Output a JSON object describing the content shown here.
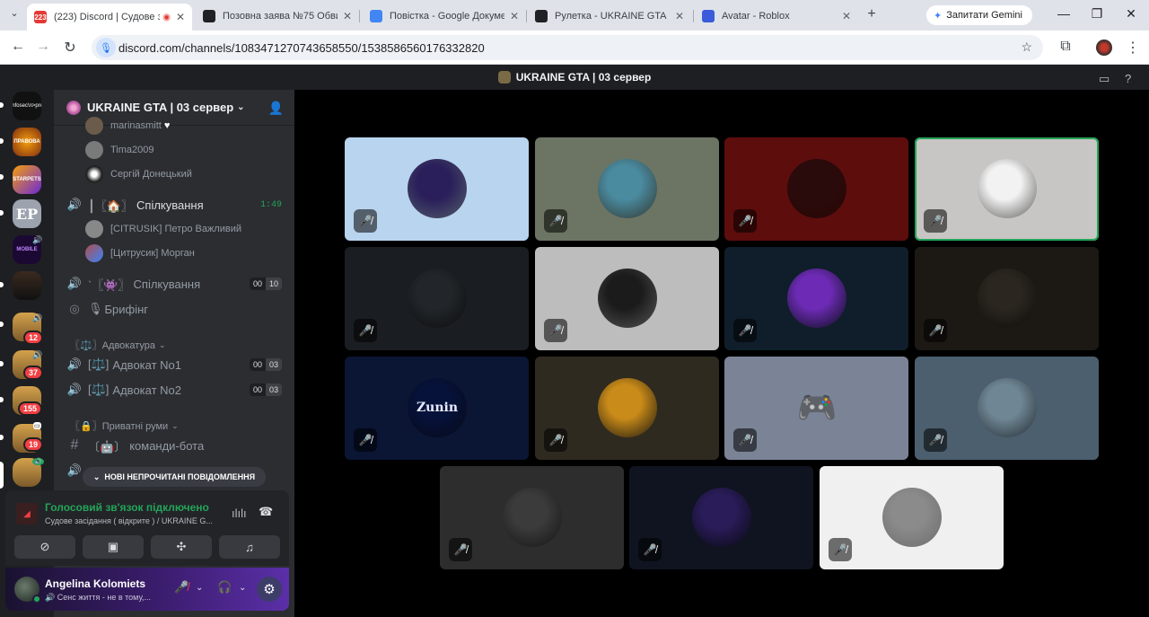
{
  "browser": {
    "tabs": [
      {
        "label": "(223) Discord | Судове за",
        "favicon_color": "#e53935",
        "favicon_text": "223"
      },
      {
        "label": "Позовна заява №75 Обвин",
        "favicon_color": "#202124",
        "favicon_text": ""
      },
      {
        "label": "Повістка - Google Докумен",
        "favicon_color": "#4285f4",
        "favicon_text": ""
      },
      {
        "label": "Рулетка - UKRAINE GTA",
        "favicon_color": "#202124",
        "favicon_text": ""
      },
      {
        "label": "Avatar - Roblox",
        "favicon_color": "#3b5bdb",
        "favicon_text": ""
      }
    ],
    "new_tab": "+",
    "gemini_label": "Запитати Gemini",
    "url": "discord.com/channels/1083471270743658550/1538586560176332820"
  },
  "discord": {
    "title": "UKRAINE GTA | 03 сервер",
    "server_name": "UKRAINE GTA | 03 сервер",
    "rail": [
      {
        "text": "#infosec\\n>prep",
        "color": "#111"
      },
      {
        "text": "ПРАВОВА",
        "color": "#c0392b"
      },
      {
        "text": "STARPETS",
        "color": "#6d28d9"
      },
      {
        "text": "EP",
        "color": "#9ca3af"
      },
      {
        "text": "MOBILE",
        "color": "#3b0764"
      },
      {
        "text": "",
        "color": "#3a2a1f"
      },
      {
        "text": "",
        "color": "#b07a2f",
        "badge": "12"
      },
      {
        "text": "",
        "color": "#b07a2f",
        "badge": "37"
      },
      {
        "text": "",
        "color": "#b07a2f",
        "badge": "155"
      },
      {
        "text": "",
        "color": "#b07a2f",
        "badge": "19"
      },
      {
        "text": "",
        "color": "#b07a2f"
      }
    ],
    "top_users": [
      {
        "name": "marinasmitt",
        "color": "#6b5b4b"
      },
      {
        "name": "Tima2009",
        "color": "#7a7a7a"
      },
      {
        "name": "Сергій Донецький",
        "color": "#222"
      }
    ],
    "channels": {
      "spilk1": {
        "name": "Спілкування",
        "time": "1:49"
      },
      "spilk1_users": [
        {
          "name": "[CITRUSIK] Петро Важливий",
          "color": "#888"
        },
        {
          "name": "[Цитрусик] Морган",
          "color": "#b04f4f"
        }
      ],
      "spilk2": {
        "name": "Спілкування",
        "cnt_a": "00",
        "cnt_b": "10"
      },
      "briefing": {
        "name": "Брифінг"
      },
      "cat_advocacy": "〖⚖️〗Адвокатура",
      "adv1": {
        "name": "Адвокат No1",
        "cnt_a": "00",
        "cnt_b": "03"
      },
      "adv2": {
        "name": "Адвокат No2",
        "cnt_a": "00",
        "cnt_b": "03"
      },
      "cat_private": "〖🔒〗Приватні руми",
      "bot": {
        "name": "команди-бота"
      }
    },
    "new_messages": "НОВІ НЕПРОЧИТАНІ ПОВІДОМЛЕННЯ",
    "voice": {
      "status": "Голосовий зв'язок підключено",
      "location": "Судове засідання ( відкрите ) / UKRAINE G..."
    },
    "user": {
      "name": "Angelina Kolomiets",
      "status": "Сенс життя - не в тому,..."
    },
    "tiles": [
      {
        "bg": "#b9d4ee",
        "avatar": "#2a1f5a"
      },
      {
        "bg": "#6c7563",
        "avatar": "#4a8ba0"
      },
      {
        "bg": "#5e0d0d",
        "avatar": "#2a0b0b"
      },
      {
        "bg": "#c8c6c4",
        "avatar": "#f2f2f2",
        "speaking": true
      },
      {
        "bg": "#1a1d21",
        "avatar": "#22262a"
      },
      {
        "bg": "#bdbdbd",
        "avatar": "#1b1b1b"
      },
      {
        "bg": "#0f1e2a",
        "avatar": "#6d2bb5"
      },
      {
        "bg": "#1c1915",
        "avatar": "#2b2620"
      },
      {
        "bg": "#0b1534",
        "avatar": "#07123a",
        "label": "Zunin"
      },
      {
        "bg": "#2f2a20",
        "avatar": "#c98b19"
      },
      {
        "bg": "#7b8397",
        "avatar": "#5865f2",
        "discord_logo": true
      },
      {
        "bg": "#4b5f6e",
        "avatar": "#6f8794"
      },
      {
        "bg": "#2d2d2d",
        "avatar": "#3b3b3b"
      },
      {
        "bg": "#0f1420",
        "avatar": "#2a1c59"
      },
      {
        "bg": "#f0f0f0",
        "avatar": "#8b8b8b"
      }
    ]
  }
}
